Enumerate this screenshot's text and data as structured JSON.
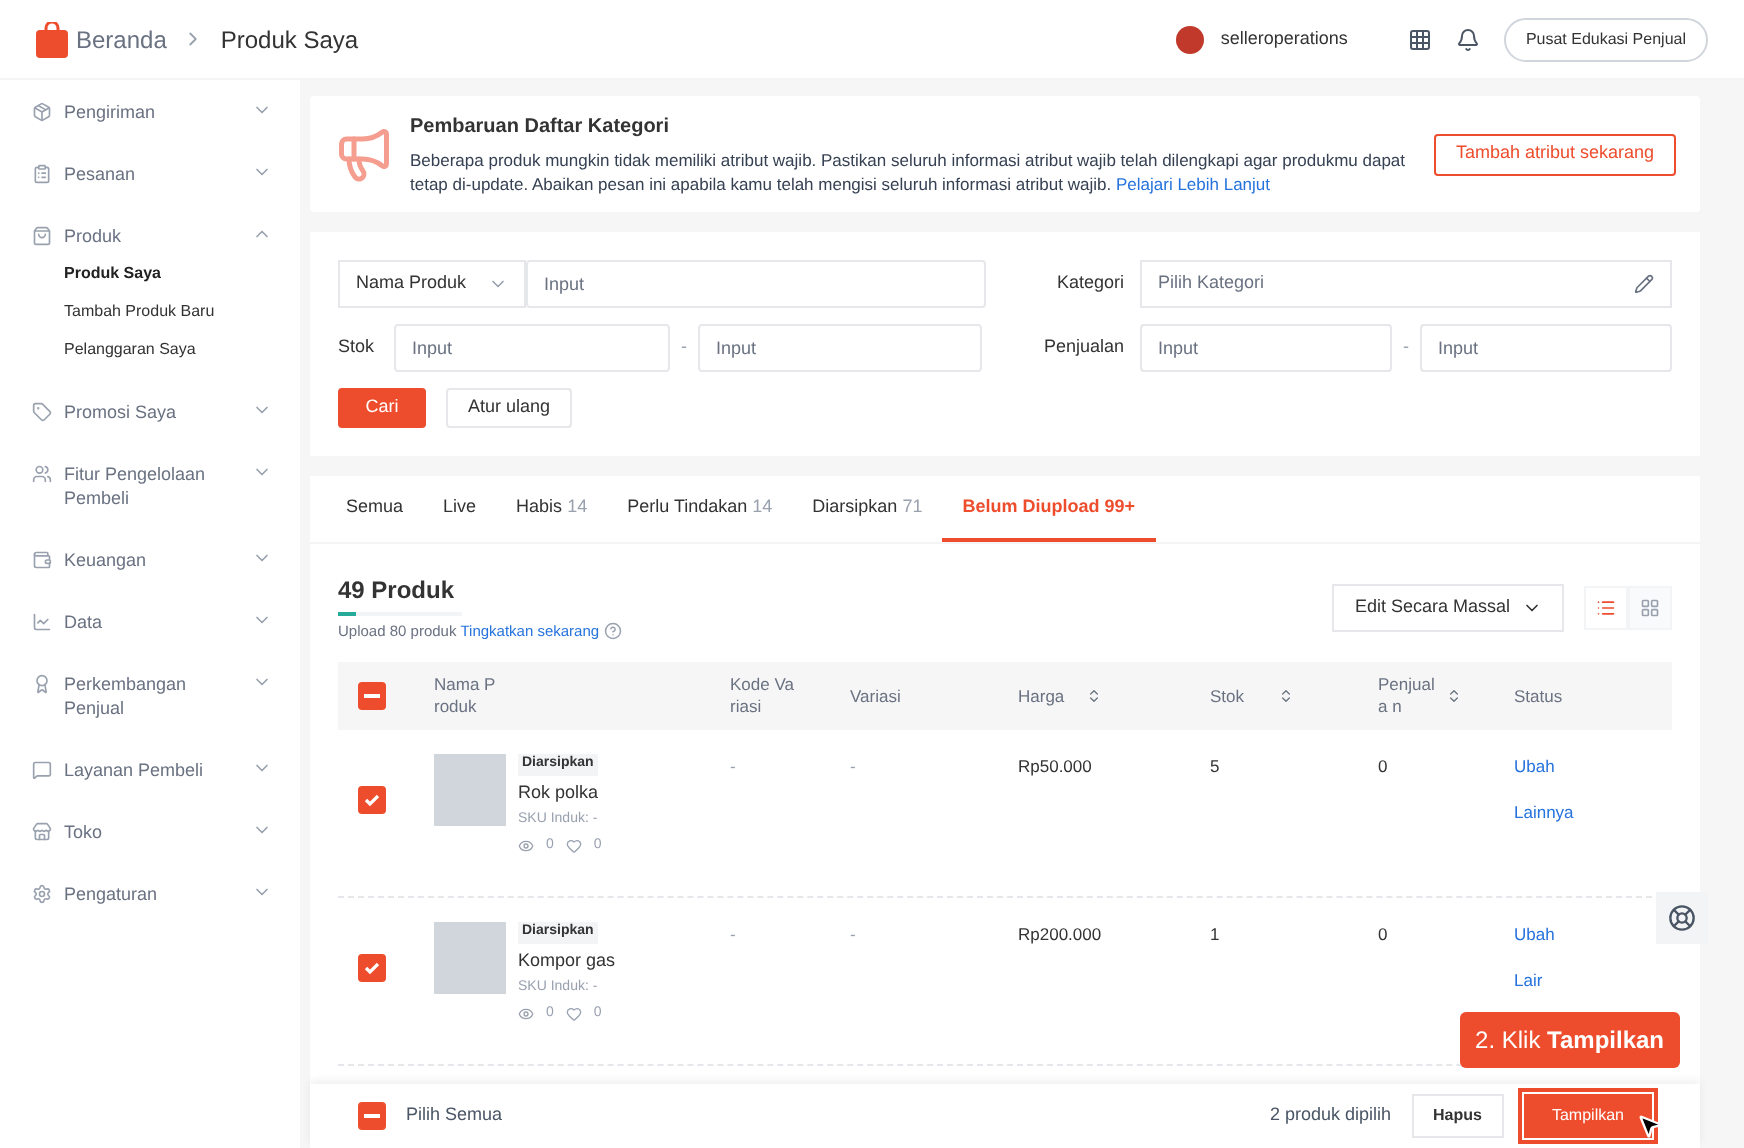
{
  "header": {
    "breadcrumb": [
      "Beranda",
      "Produk Saya"
    ],
    "username": "selleroperations",
    "help_button": "Pusat Edukasi Penjual"
  },
  "sidebar": {
    "items": [
      {
        "label": "Pengiriman",
        "expanded": false
      },
      {
        "label": "Pesanan",
        "expanded": false
      },
      {
        "label": "Produk",
        "expanded": true,
        "children": [
          {
            "label": "Produk Saya",
            "selected": true
          },
          {
            "label": "Tambah Produk Baru",
            "selected": false
          },
          {
            "label": "Pelanggaran Saya",
            "selected": false
          }
        ]
      },
      {
        "label": "Promosi Saya",
        "expanded": false
      },
      {
        "label": "Fitur Pengelolaan Pembeli",
        "expanded": false
      },
      {
        "label": "Keuangan",
        "expanded": false
      },
      {
        "label": "Data",
        "expanded": false
      },
      {
        "label": "Perkembangan Penjual",
        "expanded": false
      },
      {
        "label": "Layanan Pembeli",
        "expanded": false
      },
      {
        "label": "Toko",
        "expanded": false
      },
      {
        "label": "Pengaturan",
        "expanded": false
      }
    ]
  },
  "banner": {
    "title": "Pembaruan Daftar Kategori",
    "text": "Beberapa produk mungkin tidak memiliki atribut wajib. Pastikan seluruh informasi atribut wajib telah dilengkapi agar produkmu dapat tetap di-update. Abaikan pesan ini apabila kamu telah mengisi seluruh informasi atribut wajib.",
    "link": "Pelajari Lebih Lanjut",
    "button": "Tambah atribut sekarang"
  },
  "filters": {
    "name_select": "Nama Produk",
    "name_placeholder": "Input",
    "stok_label": "Stok",
    "stok_min_placeholder": "Input",
    "stok_max_placeholder": "Input",
    "separator_1": "-",
    "kategori_label": "Kategori",
    "kategori_placeholder": "Pilih Kategori",
    "penjualan_label": "Penjualan",
    "penjualan_min_placeholder": "Input",
    "penjualan_max_placeholder": "Input",
    "separator_2": "-",
    "search_button": "Cari",
    "reset_button": "Atur ulang"
  },
  "tabs": [
    {
      "label": "Semua",
      "selected": false
    },
    {
      "label": "Live",
      "selected": false
    },
    {
      "label": "Habis",
      "count": "14",
      "selected": false
    },
    {
      "label": "Perlu Tindakan",
      "count": "14",
      "selected": false
    },
    {
      "label": "Diarsipkan",
      "count": "71",
      "selected": false
    },
    {
      "label": "Belum Diupload 99+",
      "selected": true
    }
  ],
  "summary": {
    "title": "49 Produk",
    "level": 0.15,
    "quota_text": "Upload 80 produk",
    "upgrade_link": "Tingkatkan sekarang",
    "bulk_edit": "Edit Secara Massal",
    "view_buttons": [
      {
        "selected": true
      },
      {
        "selected": false
      }
    ]
  },
  "table": {
    "header_partial": true,
    "columns": [
      {
        "label": "Nama Produk",
        "sortable": false
      },
      {
        "label": "Kode Va riasi",
        "sortable": false
      },
      {
        "label": "Variasi",
        "sortable": false
      },
      {
        "label": "Harga",
        "sortable": true
      },
      {
        "label": "Stok",
        "sortable": true
      },
      {
        "label": "Penjuala n",
        "sortable": true
      },
      {
        "label": "Status",
        "sortable": false
      }
    ],
    "rows": [
      {
        "checked": true,
        "badge": "Diarsipkan",
        "name": "Rok polka",
        "sku": "SKU Induk: -",
        "views": "0",
        "likes": "0",
        "kode_variasi": "-",
        "variasi": "-",
        "harga": "Rp50.000",
        "stok": "5",
        "penjualan": "0",
        "actions": [
          "Ubah",
          "Lainnya"
        ]
      },
      {
        "checked": true,
        "badge": "Diarsipkan",
        "name": "Kompor gas",
        "sku": "SKU Induk: -",
        "views": "0",
        "likes": "0",
        "kode_variasi": "-",
        "variasi": "-",
        "harga": "Rp200.000",
        "stok": "1",
        "penjualan": "0",
        "actions": [
          "Ubah",
          "Lair"
        ]
      }
    ]
  },
  "footer": {
    "select_all_partial": true,
    "select_all": "Pilih Semua",
    "selected_count": "2 produk dipilih",
    "delete_button": "Hapus",
    "show_button": "Tampilkan"
  },
  "tooltip": "2. Klik **Tampilkan**"
}
